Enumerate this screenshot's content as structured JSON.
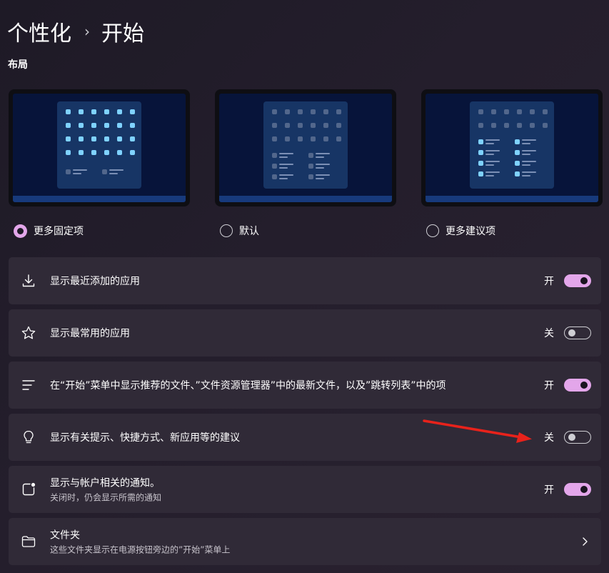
{
  "breadcrumb": {
    "parent": "个性化",
    "separator": "›",
    "current": "开始"
  },
  "layout": {
    "title": "布局",
    "options": [
      {
        "label": "更多固定项",
        "selected": true
      },
      {
        "label": "默认",
        "selected": false
      },
      {
        "label": "更多建议项",
        "selected": false
      }
    ]
  },
  "settings": [
    {
      "label": "显示最近添加的应用",
      "state": "开",
      "on": true,
      "icon": "download-icon"
    },
    {
      "label": "显示最常用的应用",
      "state": "关",
      "on": false,
      "icon": "star-icon"
    },
    {
      "label": "在“开始”菜单中显示推荐的文件、”文件资源管理器”中的最新文件，以及”跳转列表”中的项",
      "state": "开",
      "on": true,
      "icon": "list-icon"
    },
    {
      "label": "显示有关提示、快捷方式、新应用等的建议",
      "state": "关",
      "on": false,
      "icon": "lightbulb-icon"
    },
    {
      "label": "显示与帐户相关的通知。",
      "sublabel": "关闭时，仍会显示所需的通知",
      "state": "开",
      "on": true,
      "icon": "notification-icon"
    },
    {
      "label": "文件夹",
      "sublabel": "这些文件夹显示在电源按钮旁边的”开始”菜单上",
      "icon": "folder-icon",
      "chevron": "chevron-right-icon"
    }
  ],
  "colors": {
    "accent": "#e3a6ea",
    "row_bg": "#302a37",
    "annotation_arrow": "#e8221b"
  }
}
